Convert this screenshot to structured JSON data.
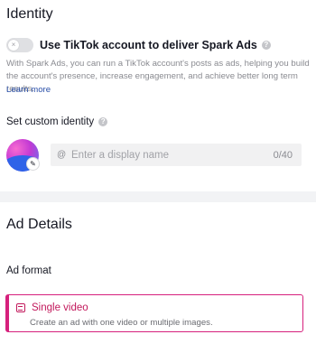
{
  "identity": {
    "title": "Identity",
    "spark_toggle": {
      "label": "Use TikTok account to deliver Spark Ads",
      "enabled": false,
      "knob_glyph": "×"
    },
    "help_glyph": "?",
    "description": "With Spark Ads, you can run a TikTok account's posts as ads, helping you build the account's presence, increase engagement, and achieve better long term results.",
    "learn_more": "Learn more",
    "custom_identity": {
      "label": "Set custom identity",
      "at_symbol": "@",
      "placeholder": "Enter a display name",
      "value": "",
      "counter": "0/40",
      "edit_glyph": "✎"
    }
  },
  "ad_details": {
    "title": "Ad Details",
    "ad_format_label": "Ad format",
    "selected_format": {
      "title": "Single video",
      "description": "Create an ad with one video or multiple images."
    }
  },
  "colors": {
    "accent": "#c2185b",
    "accent_border": "#d6207c",
    "link": "#2a4fa8",
    "muted_text": "#8a8b91",
    "page_bg": "#f2f3f5"
  }
}
